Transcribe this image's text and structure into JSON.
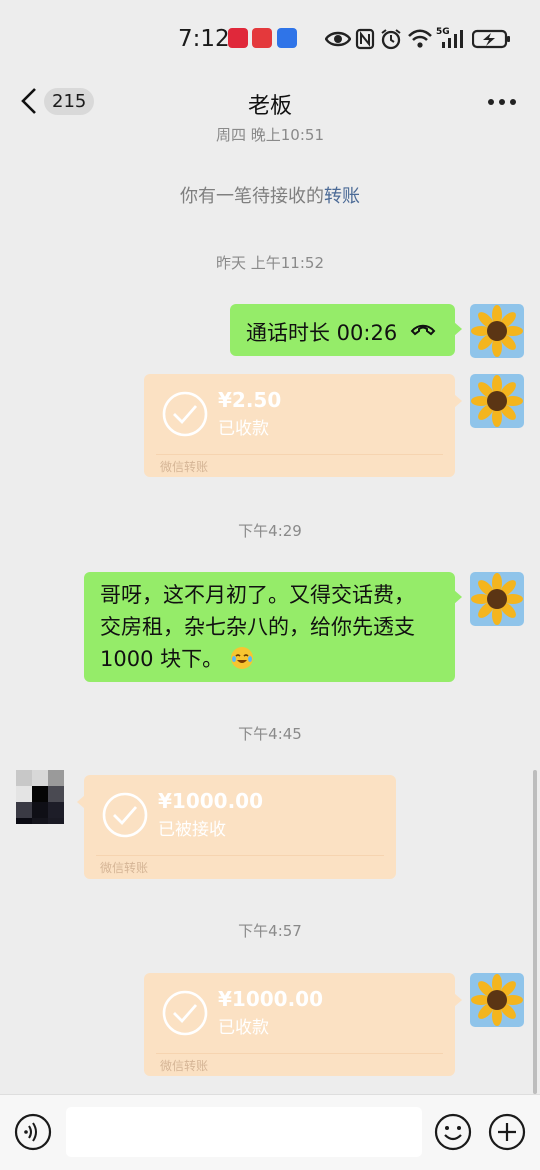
{
  "status_bar": {
    "time": "7:12",
    "icons": [
      "huawei-app-icon",
      "shopping-app-icon",
      "map-app-icon",
      "eye-icon",
      "nfc-icon",
      "alarm-icon",
      "wifi-icon",
      "5g-signal-icon",
      "battery-charging-icon"
    ],
    "network": "5G"
  },
  "nav": {
    "unread_count": "215",
    "title": "老板",
    "back_icon": "chevron-left-icon",
    "more_icon": "more-dots-icon"
  },
  "messages": {
    "top_ts": "周四 晚上10:51",
    "system_notice_prefix": "你有一笔待接收的",
    "system_notice_link": "转账",
    "ts1": "昨天 上午11:52",
    "call_text": "通话时长 00:26",
    "t1_amount": "¥2.50",
    "t1_status": "已收款",
    "t1_brand": "微信转账",
    "ts2": "下午4:29",
    "msg_line1": "哥呀，这不月初了。又得交话费，",
    "msg_line2": "交房租，杂七杂八的，给你先透支",
    "msg_line3": "1000 块下。",
    "msg_emoji": "face-with-tears-of-joy-icon",
    "ts3": "下午4:45",
    "t2_amount": "¥1000.00",
    "t2_status": "已被接收",
    "t2_brand": "微信转账",
    "ts4": "下午4:57",
    "t3_amount": "¥1000.00",
    "t3_status": "已收款",
    "t3_brand": "微信转账"
  },
  "colors": {
    "background": "#ededed",
    "sent_bubble": "#95ec69",
    "transfer_card": "#fbe1c3",
    "link": "#4b6a96"
  },
  "input_bar": {
    "text_value": "",
    "voice_icon": "voice-input-icon",
    "emoji_icon": "emoji-icon",
    "plus_icon": "plus-circle-icon"
  }
}
